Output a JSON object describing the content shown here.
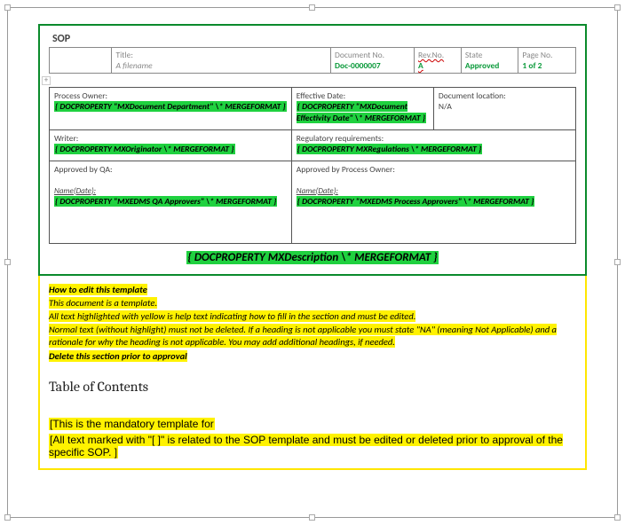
{
  "header": {
    "sop_label": "SOP",
    "title_label": "Title:",
    "title_value": "A filename",
    "docno_label": "Document No.",
    "docno_value": "Doc-0000007",
    "revno_label": "Rev.No.",
    "revno_value": "A",
    "state_label": "State",
    "state_value": "Approved",
    "pageno_label": "Page No.",
    "pageno_value": "1 of 2"
  },
  "meta": {
    "process_owner_label": "Process Owner:",
    "process_owner_field": "{ DOCPROPERTY  \"MXDocument Department\"  \\* MERGEFORMAT }",
    "effective_date_label": "Effective Date:",
    "effective_date_field": "{ DOCPROPERTY  \"MXDocument Effectivity Date\"  \\* MERGEFORMAT }",
    "doc_location_label": "Document location:",
    "doc_location_value": "N/A",
    "writer_label": "Writer:",
    "writer_field": "{ DOCPROPERTY  MXOriginator \\* MERGEFORMAT }",
    "reg_req_label": "Regulatory requirements:",
    "reg_req_field": "{ DOCPROPERTY  MXRegulations  \\* MERGEFORMAT }",
    "approved_qa_label": "Approved by QA:",
    "approved_po_label": "Approved by Process Owner:",
    "name_date_label": "Name(Date):",
    "qa_approvers_field": "{ DOCPROPERTY  \"MXEDMS QA Approvers\"  \\* MERGEFORMAT }",
    "po_approvers_field": "{ DOCPROPERTY  \"MXEDMS Process Approvers\"  \\* MERGEFORMAT }"
  },
  "description_field": "{ DOCPROPERTY  MXDescription  \\* MERGEFORMAT }",
  "help": {
    "h1": "How to edit this template",
    "l1": "This document is a template.",
    "l2": "All text highlighted with yellow is help text indicating how to fill in the section and must be edited.",
    "l3": "Normal text (without highlight) must not be deleted. If a heading is not applicable you must state \"NA\" (meaning Not Applicable) and a rationale for why the heading is not applicable. You may add additional headings, if needed.",
    "l4": "Delete this section prior to approval"
  },
  "toc_label": "Table of Contents",
  "mandatory": {
    "m1": "[This is the mandatory template for",
    "m2": "[All text marked with \"[ ]\" is related to the SOP template and must be edited or deleted prior to approval of the specific SOP. ]"
  }
}
